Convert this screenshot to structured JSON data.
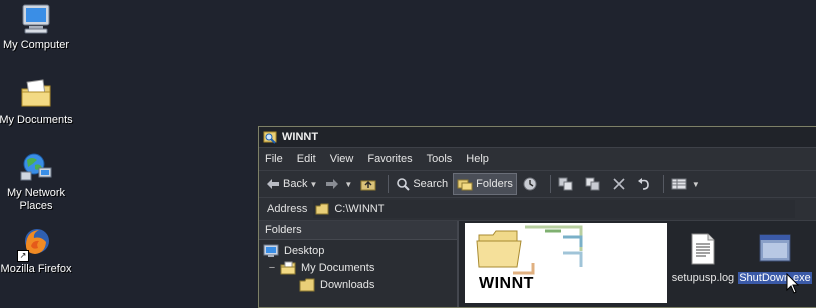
{
  "desktop": {
    "icons": [
      {
        "label": "My Computer",
        "icon": "my-computer-icon"
      },
      {
        "label": "My Documents",
        "icon": "my-documents-icon"
      },
      {
        "label": "My Network\nPlaces",
        "line1": "My Network",
        "line2": "Places",
        "icon": "network-places-icon"
      },
      {
        "label": "Mozilla Firefox",
        "icon": "firefox-icon"
      }
    ]
  },
  "window": {
    "title": "WINNT",
    "menu": [
      "File",
      "Edit",
      "View",
      "Favorites",
      "Tools",
      "Help"
    ],
    "toolbar": {
      "back": "Back",
      "search": "Search",
      "folders": "Folders"
    },
    "address": {
      "label": "Address",
      "value": "C:\\WINNT"
    },
    "folders_pane": {
      "header": "Folders",
      "items": [
        {
          "label": "Desktop",
          "indent": 0,
          "expander": ""
        },
        {
          "label": "My Documents",
          "indent": 1,
          "expander": "−"
        },
        {
          "label": "Downloads",
          "indent": 2,
          "expander": ""
        }
      ]
    },
    "content": {
      "banner_title": "WINNT",
      "files": [
        {
          "name": "setupusp.log",
          "icon": "text-file-icon",
          "selected": false
        },
        {
          "name": "ShutDown.exe",
          "icon": "application-icon",
          "selected": true
        }
      ]
    }
  },
  "colors": {
    "desktop_bg": "#1f232e",
    "window_bg": "#2a2d33",
    "selection": "#3b5aa8"
  }
}
